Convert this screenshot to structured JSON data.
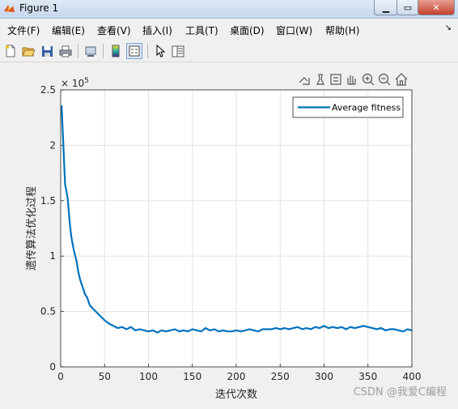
{
  "window": {
    "title": "Figure 1",
    "controls": [
      "minimize",
      "maximize",
      "close"
    ]
  },
  "menu": {
    "items": [
      {
        "label": "文件(F)"
      },
      {
        "label": "编辑(E)"
      },
      {
        "label": "查看(V)"
      },
      {
        "label": "插入(I)"
      },
      {
        "label": "工具(T)"
      },
      {
        "label": "桌面(D)"
      },
      {
        "label": "窗口(W)"
      },
      {
        "label": "帮助(H)"
      }
    ],
    "overflow_icon": "chevron-icon"
  },
  "toolbar": {
    "icons": [
      "new-figure-icon",
      "open-file-icon",
      "save-icon",
      "print-icon",
      "link-icon",
      "colorbar-icon",
      "legend-icon",
      "pointer-icon",
      "property-editor-icon"
    ]
  },
  "axes_toolbar": {
    "icons": [
      "export-icon",
      "brush-icon",
      "data-tip-icon",
      "pan-icon",
      "zoom-in-icon",
      "zoom-out-icon",
      "home-icon"
    ]
  },
  "watermark": "CSDN @我爱C编程",
  "colors": {
    "series": "#0072bd",
    "grid": "#e3e3e3"
  },
  "chart_data": {
    "type": "line",
    "xlabel": "迭代次数",
    "ylabel": "遗传算法优化过程",
    "exponent_label": "× 10",
    "exponent_power": "5",
    "xlim": [
      0,
      400
    ],
    "ylim": [
      0,
      2.5
    ],
    "xticks": [
      "0",
      "50",
      "100",
      "150",
      "200",
      "250",
      "300",
      "350",
      "400"
    ],
    "yticks": [
      "0",
      "0.5",
      "1",
      "1.5",
      "2",
      "2.5"
    ],
    "grid": true,
    "legend_position": "top-right",
    "series": [
      {
        "name": "Average fitness",
        "x": [
          1,
          3,
          5,
          8,
          10,
          12,
          15,
          18,
          20,
          22,
          25,
          28,
          30,
          33,
          36,
          40,
          45,
          50,
          55,
          60,
          65,
          70,
          75,
          80,
          85,
          90,
          95,
          100,
          105,
          110,
          115,
          120,
          125,
          130,
          135,
          140,
          145,
          150,
          155,
          160,
          165,
          170,
          175,
          180,
          185,
          190,
          195,
          200,
          205,
          210,
          215,
          220,
          225,
          230,
          235,
          240,
          245,
          250,
          255,
          260,
          265,
          270,
          275,
          280,
          285,
          290,
          295,
          300,
          305,
          310,
          315,
          320,
          325,
          330,
          335,
          340,
          345,
          350,
          355,
          360,
          365,
          370,
          375,
          380,
          385,
          390,
          395,
          400
        ],
        "y": [
          2.36,
          2.0,
          1.65,
          1.52,
          1.33,
          1.18,
          1.05,
          0.96,
          0.86,
          0.79,
          0.72,
          0.65,
          0.63,
          0.56,
          0.53,
          0.5,
          0.46,
          0.42,
          0.39,
          0.37,
          0.35,
          0.36,
          0.34,
          0.36,
          0.33,
          0.34,
          0.33,
          0.32,
          0.33,
          0.31,
          0.33,
          0.32,
          0.33,
          0.34,
          0.32,
          0.33,
          0.32,
          0.34,
          0.33,
          0.32,
          0.35,
          0.33,
          0.34,
          0.32,
          0.33,
          0.32,
          0.32,
          0.33,
          0.32,
          0.33,
          0.34,
          0.33,
          0.32,
          0.34,
          0.34,
          0.34,
          0.35,
          0.34,
          0.35,
          0.34,
          0.35,
          0.36,
          0.34,
          0.35,
          0.34,
          0.36,
          0.35,
          0.37,
          0.35,
          0.36,
          0.35,
          0.36,
          0.34,
          0.36,
          0.35,
          0.36,
          0.37,
          0.36,
          0.35,
          0.34,
          0.35,
          0.33,
          0.34,
          0.34,
          0.33,
          0.32,
          0.34,
          0.33
        ]
      }
    ]
  }
}
